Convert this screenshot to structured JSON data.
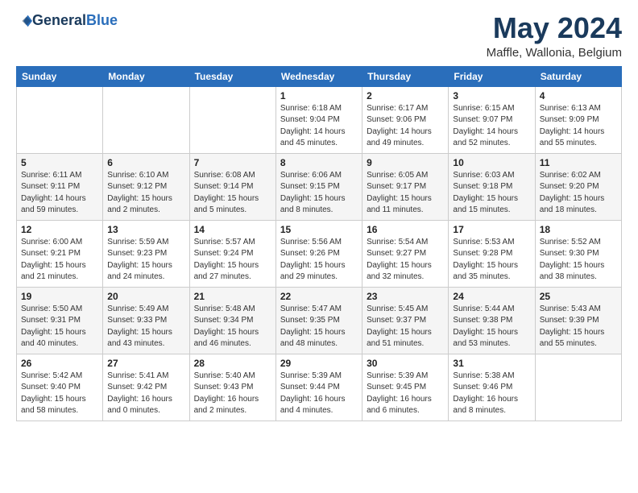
{
  "header": {
    "logo_general": "General",
    "logo_blue": "Blue",
    "month_title": "May 2024",
    "location": "Maffle, Wallonia, Belgium"
  },
  "weekdays": [
    "Sunday",
    "Monday",
    "Tuesday",
    "Wednesday",
    "Thursday",
    "Friday",
    "Saturday"
  ],
  "weeks": [
    [
      {
        "day": "",
        "info": ""
      },
      {
        "day": "",
        "info": ""
      },
      {
        "day": "",
        "info": ""
      },
      {
        "day": "1",
        "info": "Sunrise: 6:18 AM\nSunset: 9:04 PM\nDaylight: 14 hours\nand 45 minutes."
      },
      {
        "day": "2",
        "info": "Sunrise: 6:17 AM\nSunset: 9:06 PM\nDaylight: 14 hours\nand 49 minutes."
      },
      {
        "day": "3",
        "info": "Sunrise: 6:15 AM\nSunset: 9:07 PM\nDaylight: 14 hours\nand 52 minutes."
      },
      {
        "day": "4",
        "info": "Sunrise: 6:13 AM\nSunset: 9:09 PM\nDaylight: 14 hours\nand 55 minutes."
      }
    ],
    [
      {
        "day": "5",
        "info": "Sunrise: 6:11 AM\nSunset: 9:11 PM\nDaylight: 14 hours\nand 59 minutes."
      },
      {
        "day": "6",
        "info": "Sunrise: 6:10 AM\nSunset: 9:12 PM\nDaylight: 15 hours\nand 2 minutes."
      },
      {
        "day": "7",
        "info": "Sunrise: 6:08 AM\nSunset: 9:14 PM\nDaylight: 15 hours\nand 5 minutes."
      },
      {
        "day": "8",
        "info": "Sunrise: 6:06 AM\nSunset: 9:15 PM\nDaylight: 15 hours\nand 8 minutes."
      },
      {
        "day": "9",
        "info": "Sunrise: 6:05 AM\nSunset: 9:17 PM\nDaylight: 15 hours\nand 11 minutes."
      },
      {
        "day": "10",
        "info": "Sunrise: 6:03 AM\nSunset: 9:18 PM\nDaylight: 15 hours\nand 15 minutes."
      },
      {
        "day": "11",
        "info": "Sunrise: 6:02 AM\nSunset: 9:20 PM\nDaylight: 15 hours\nand 18 minutes."
      }
    ],
    [
      {
        "day": "12",
        "info": "Sunrise: 6:00 AM\nSunset: 9:21 PM\nDaylight: 15 hours\nand 21 minutes."
      },
      {
        "day": "13",
        "info": "Sunrise: 5:59 AM\nSunset: 9:23 PM\nDaylight: 15 hours\nand 24 minutes."
      },
      {
        "day": "14",
        "info": "Sunrise: 5:57 AM\nSunset: 9:24 PM\nDaylight: 15 hours\nand 27 minutes."
      },
      {
        "day": "15",
        "info": "Sunrise: 5:56 AM\nSunset: 9:26 PM\nDaylight: 15 hours\nand 29 minutes."
      },
      {
        "day": "16",
        "info": "Sunrise: 5:54 AM\nSunset: 9:27 PM\nDaylight: 15 hours\nand 32 minutes."
      },
      {
        "day": "17",
        "info": "Sunrise: 5:53 AM\nSunset: 9:28 PM\nDaylight: 15 hours\nand 35 minutes."
      },
      {
        "day": "18",
        "info": "Sunrise: 5:52 AM\nSunset: 9:30 PM\nDaylight: 15 hours\nand 38 minutes."
      }
    ],
    [
      {
        "day": "19",
        "info": "Sunrise: 5:50 AM\nSunset: 9:31 PM\nDaylight: 15 hours\nand 40 minutes."
      },
      {
        "day": "20",
        "info": "Sunrise: 5:49 AM\nSunset: 9:33 PM\nDaylight: 15 hours\nand 43 minutes."
      },
      {
        "day": "21",
        "info": "Sunrise: 5:48 AM\nSunset: 9:34 PM\nDaylight: 15 hours\nand 46 minutes."
      },
      {
        "day": "22",
        "info": "Sunrise: 5:47 AM\nSunset: 9:35 PM\nDaylight: 15 hours\nand 48 minutes."
      },
      {
        "day": "23",
        "info": "Sunrise: 5:45 AM\nSunset: 9:37 PM\nDaylight: 15 hours\nand 51 minutes."
      },
      {
        "day": "24",
        "info": "Sunrise: 5:44 AM\nSunset: 9:38 PM\nDaylight: 15 hours\nand 53 minutes."
      },
      {
        "day": "25",
        "info": "Sunrise: 5:43 AM\nSunset: 9:39 PM\nDaylight: 15 hours\nand 55 minutes."
      }
    ],
    [
      {
        "day": "26",
        "info": "Sunrise: 5:42 AM\nSunset: 9:40 PM\nDaylight: 15 hours\nand 58 minutes."
      },
      {
        "day": "27",
        "info": "Sunrise: 5:41 AM\nSunset: 9:42 PM\nDaylight: 16 hours\nand 0 minutes."
      },
      {
        "day": "28",
        "info": "Sunrise: 5:40 AM\nSunset: 9:43 PM\nDaylight: 16 hours\nand 2 minutes."
      },
      {
        "day": "29",
        "info": "Sunrise: 5:39 AM\nSunset: 9:44 PM\nDaylight: 16 hours\nand 4 minutes."
      },
      {
        "day": "30",
        "info": "Sunrise: 5:39 AM\nSunset: 9:45 PM\nDaylight: 16 hours\nand 6 minutes."
      },
      {
        "day": "31",
        "info": "Sunrise: 5:38 AM\nSunset: 9:46 PM\nDaylight: 16 hours\nand 8 minutes."
      },
      {
        "day": "",
        "info": ""
      }
    ]
  ]
}
